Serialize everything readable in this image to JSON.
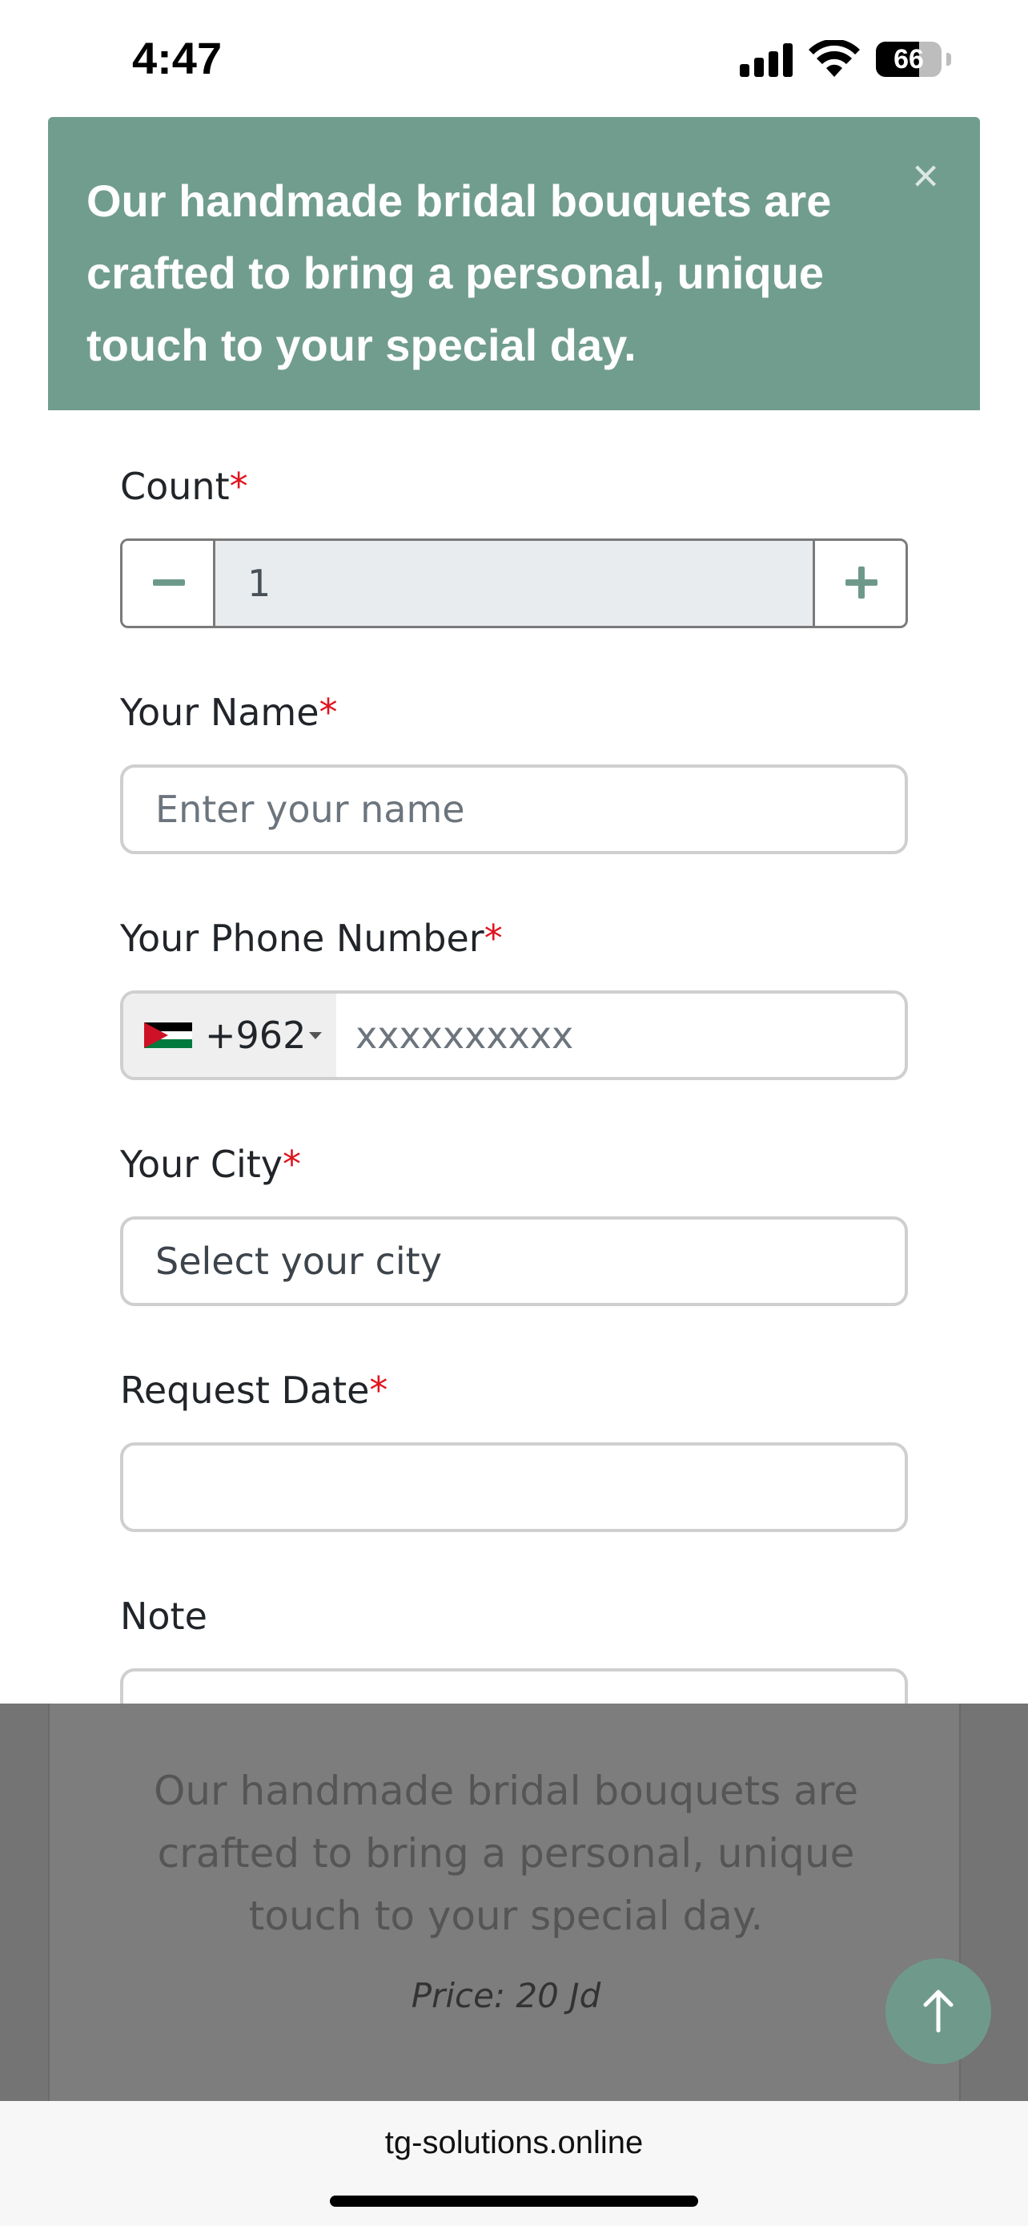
{
  "status_bar": {
    "time": "4:47",
    "battery": "66",
    "battery_level": 0.66,
    "icons": [
      "signal-icon",
      "wifi-icon",
      "battery-icon"
    ]
  },
  "banner": {
    "message": "Our handmade bridal bouquets are crafted to bring a personal, unique touch to your special day.",
    "close_symbol": "×",
    "background_color": "#719d8e"
  },
  "form": {
    "required_mark": "*",
    "count": {
      "label": "Count",
      "value": "1",
      "minus_icon": "minus-icon",
      "plus_icon": "plus-icon"
    },
    "name": {
      "label": "Your Name",
      "placeholder": "Enter your name"
    },
    "phone": {
      "label": "Your Phone Number",
      "dial_code": "+962",
      "country_flag": "jordan-flag-icon",
      "placeholder": "xxxxxxxxxx"
    },
    "city": {
      "label": "Your City",
      "value": "Select your city"
    },
    "request_date": {
      "label": "Request Date",
      "value": ""
    },
    "note": {
      "label": "Note"
    }
  },
  "product_overlay": {
    "description": "Our handmade bridal bouquets are crafted to bring a personal, unique touch to your special day.",
    "price": "Price: 20 Jd"
  },
  "scroll_top_button": {
    "icon": "arrow-up-icon",
    "color": "#6f9a8b"
  },
  "browser": {
    "url": "tg-solutions.online"
  },
  "colors": {
    "accent": "#719d8e",
    "required": "#e0141d"
  }
}
